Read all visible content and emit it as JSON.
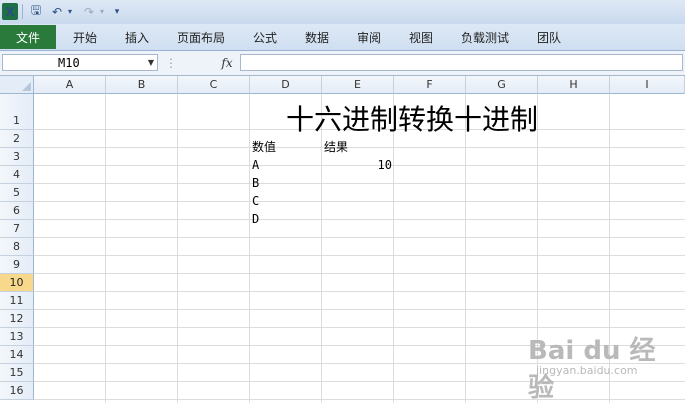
{
  "app": {
    "logo_letter": "X",
    "quick_access": {
      "save": "🖫",
      "undo": "↶",
      "dropdown": "▾",
      "redo": "↷",
      "customize": "▾"
    }
  },
  "ribbon": {
    "file_tab": "文件",
    "tabs": [
      "开始",
      "插入",
      "页面布局",
      "公式",
      "数据",
      "审阅",
      "视图",
      "负载测试",
      "团队"
    ]
  },
  "formula_bar": {
    "name_box": "M10",
    "fx": "fx",
    "formula": ""
  },
  "sheet": {
    "columns": [
      "A",
      "B",
      "C",
      "D",
      "E",
      "F",
      "G",
      "H",
      "I"
    ],
    "rows": [
      "1",
      "2",
      "3",
      "4",
      "5",
      "6",
      "7",
      "8",
      "9",
      "10",
      "11",
      "12",
      "13",
      "14",
      "15",
      "16"
    ],
    "selected_row": "10",
    "cells": {
      "title": "十六进制转换十进制",
      "D2": "数值",
      "E2": "结果",
      "D3": "A",
      "E3": "10",
      "D4": "B",
      "D5": "C",
      "D6": "D"
    }
  },
  "watermark": {
    "logo": "Bai du 经验",
    "url": "jingyan.baidu.com"
  },
  "colors": {
    "file_tab": "#2a7a3b",
    "selected_row_header": "#f8d98b",
    "grid_line": "#dadcdd"
  }
}
